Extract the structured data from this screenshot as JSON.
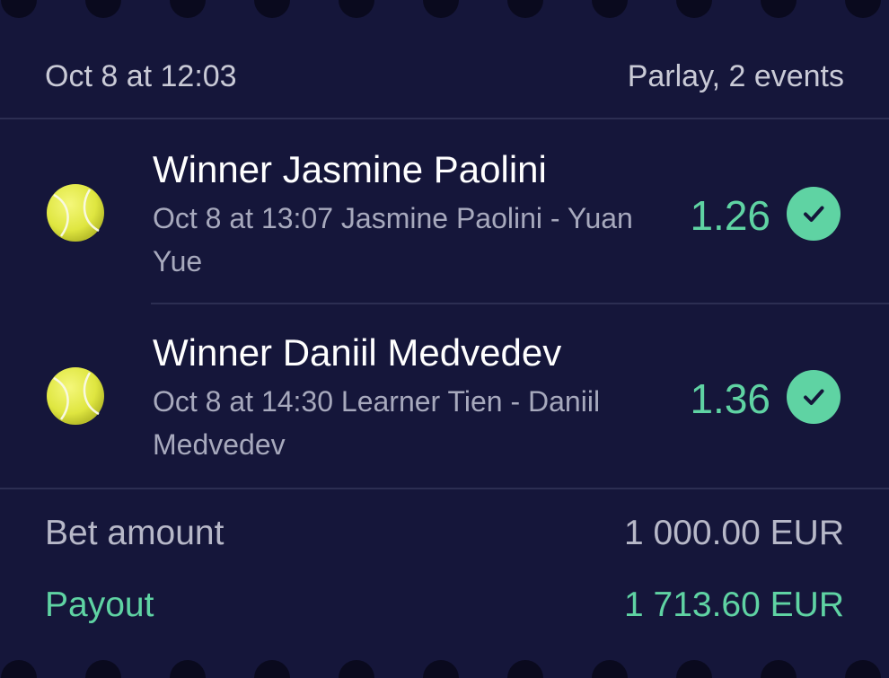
{
  "header": {
    "date": "Oct 8 at 12:03",
    "type": "Parlay, 2 events"
  },
  "events": [
    {
      "sport_icon": "tennis-ball-icon",
      "title": "Winner Jasmine Paolini",
      "description": "Oct 8 at 13:07 Jasmine Paolini - Yuan Yue",
      "odds": "1.26",
      "status_icon": "check-circle-icon"
    },
    {
      "sport_icon": "tennis-ball-icon",
      "title": "Winner Daniil Medvedev",
      "description": "Oct 8 at 14:30 Learner Tien - Daniil Medvedev",
      "odds": "1.36",
      "status_icon": "check-circle-icon"
    }
  ],
  "summary": {
    "bet_label": "Bet amount",
    "bet_value": "1 000.00 EUR",
    "payout_label": "Payout",
    "payout_value": "1 713.60 EUR"
  },
  "colors": {
    "background": "#15163a",
    "accent": "#5fd3a3",
    "muted_text": "#a7a9bd",
    "ball": "#e4ea4a"
  }
}
